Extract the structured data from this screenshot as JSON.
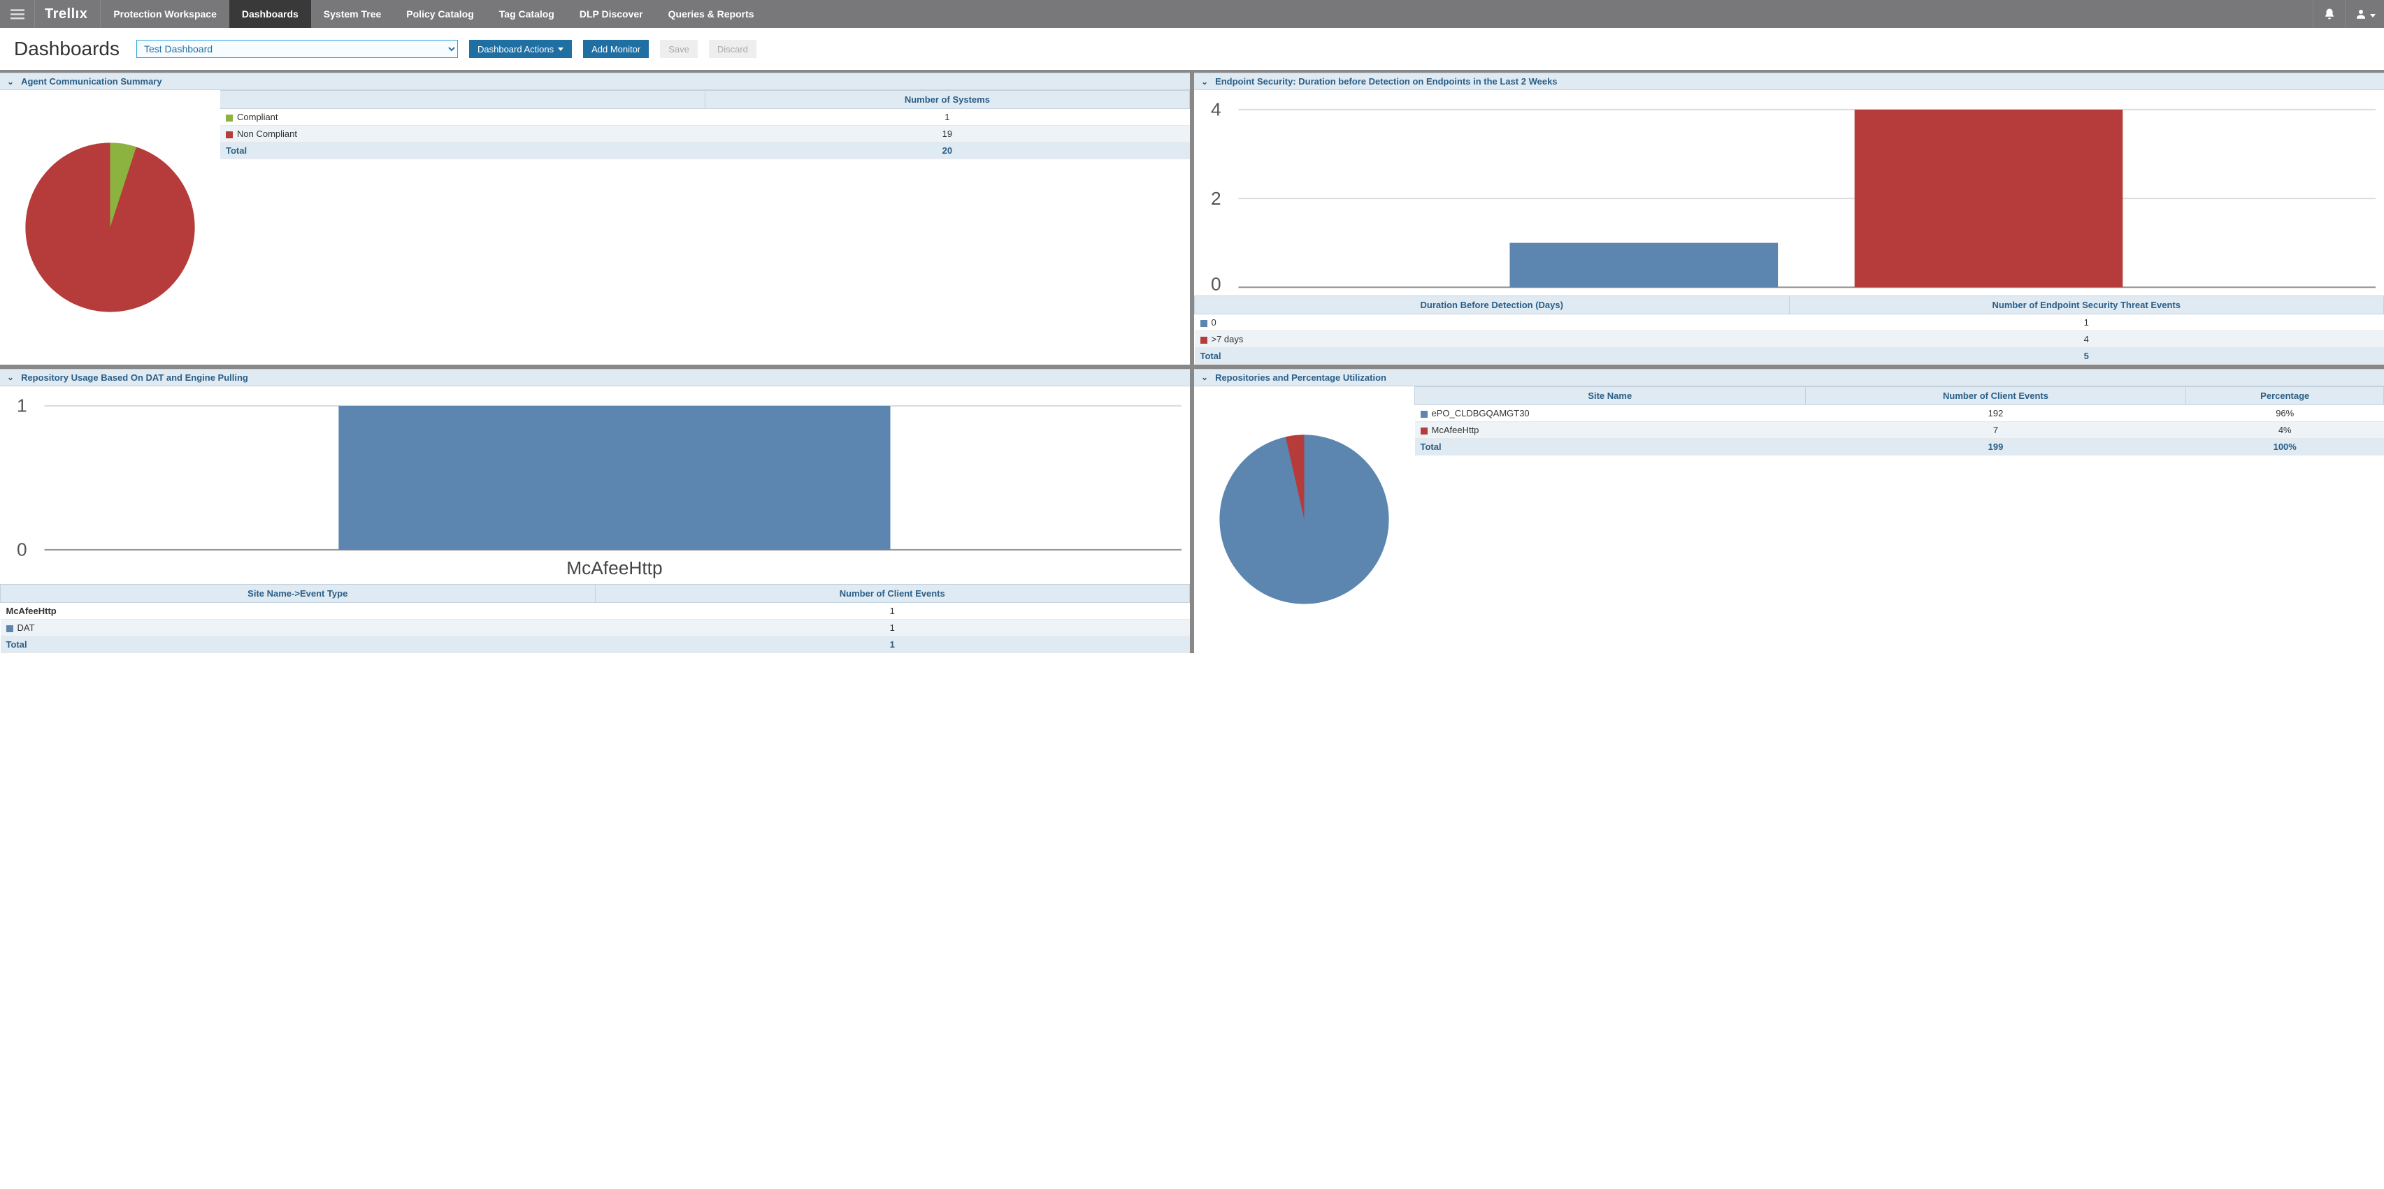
{
  "brand": "Trellıx",
  "nav": {
    "items": [
      "Protection Workspace",
      "Dashboards",
      "System Tree",
      "Policy Catalog",
      "Tag Catalog",
      "DLP Discover",
      "Queries & Reports"
    ],
    "active_index": 1
  },
  "page_title": "Dashboards",
  "dashboard_select_value": "Test Dashboard",
  "buttons": {
    "dashboard_actions": "Dashboard Actions",
    "add_monitor": "Add Monitor",
    "save": "Save",
    "discard": "Discard"
  },
  "panels": {
    "agent_comm": {
      "title": "Agent Communication Summary",
      "table_header": "Number of Systems",
      "rows": [
        {
          "label": "Compliant",
          "color": "#8cb33f",
          "value": 1
        },
        {
          "label": "Non Compliant",
          "color": "#b53c3a",
          "value": 19
        }
      ],
      "total_label": "Total",
      "total_value": 20
    },
    "endpoint_sec": {
      "title": "Endpoint Security: Duration before Detection on Endpoints in the Last 2 Weeks",
      "col1": "Duration Before Detection (Days)",
      "col2": "Number of Endpoint Security Threat Events",
      "rows": [
        {
          "label": "0",
          "color": "#5c86b0",
          "value": 1
        },
        {
          "label": ">7 days",
          "color": "#b53c3a",
          "value": 4
        }
      ],
      "total_label": "Total",
      "total_value": 5,
      "y_ticks": [
        "4",
        "2",
        "0"
      ]
    },
    "repo_usage": {
      "title": "Repository Usage Based On DAT and Engine Pulling",
      "col1": "Site Name->Event Type",
      "col2": "Number of Client Events",
      "category_label": "McAfeeHttp",
      "group_row": "McAfeeHttp",
      "detail_row": {
        "label": "DAT",
        "color": "#5c86b0",
        "value": 1
      },
      "total_label": "Total",
      "total_value": 1,
      "y_ticks": [
        "1",
        "0"
      ]
    },
    "repo_pct": {
      "title": "Repositories and Percentage Utilization",
      "headers": [
        "Site Name",
        "Number of Client Events",
        "Percentage"
      ],
      "rows": [
        {
          "label": "ePO_CLDBGQAMGT30",
          "color": "#5c86b0",
          "events": 192,
          "pct": "96%"
        },
        {
          "label": "McAfeeHttp",
          "color": "#b53c3a",
          "events": 7,
          "pct": "4%"
        }
      ],
      "total_label": "Total",
      "total_events": 199,
      "total_pct": "100%"
    }
  },
  "chart_data": [
    {
      "type": "pie",
      "title": "Agent Communication Summary",
      "series": [
        {
          "name": "Compliant",
          "value": 1,
          "color": "#8cb33f"
        },
        {
          "name": "Non Compliant",
          "value": 19,
          "color": "#b53c3a"
        }
      ],
      "total": 20
    },
    {
      "type": "bar",
      "title": "Endpoint Security: Duration before Detection on Endpoints in the Last 2 Weeks",
      "categories": [
        "0",
        ">7 days"
      ],
      "values": [
        1,
        4
      ],
      "colors": [
        "#5c86b0",
        "#b53c3a"
      ],
      "ylabel": "Number of Endpoint Security Threat Events",
      "ylim": [
        0,
        4
      ]
    },
    {
      "type": "bar",
      "title": "Repository Usage Based On DAT and Engine Pulling",
      "categories": [
        "McAfeeHttp"
      ],
      "values": [
        1
      ],
      "colors": [
        "#5c86b0"
      ],
      "ylabel": "Number of Client Events",
      "ylim": [
        0,
        1
      ]
    },
    {
      "type": "pie",
      "title": "Repositories and Percentage Utilization",
      "series": [
        {
          "name": "ePO_CLDBGQAMGT30",
          "value": 192,
          "pct": "96%",
          "color": "#5c86b0"
        },
        {
          "name": "McAfeeHttp",
          "value": 7,
          "pct": "4%",
          "color": "#b53c3a"
        }
      ],
      "total": 199
    }
  ]
}
